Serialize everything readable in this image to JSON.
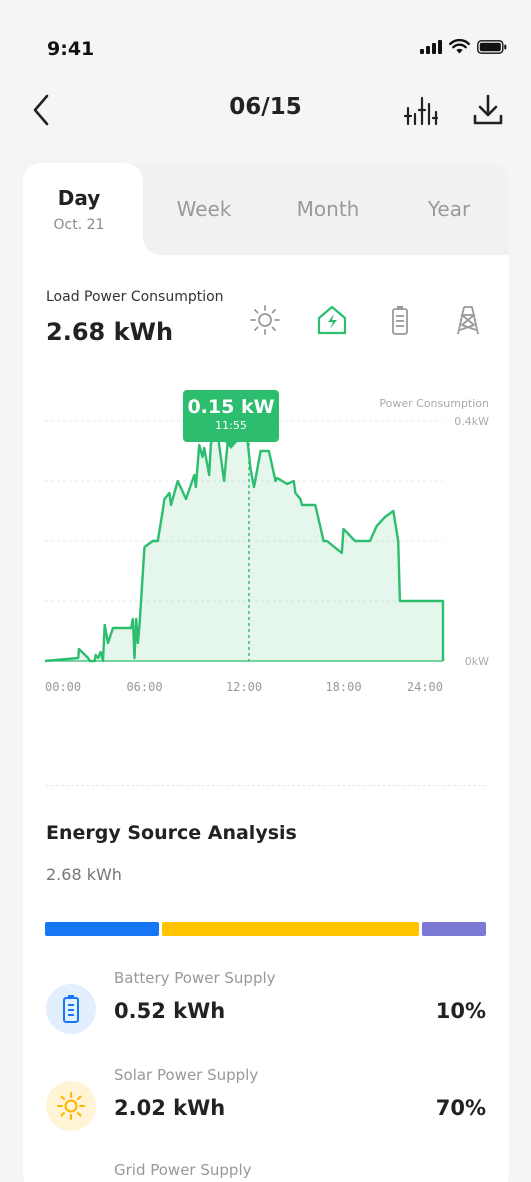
{
  "status": {
    "time": "9:41"
  },
  "header": {
    "title": "06/15"
  },
  "tabs": {
    "day": {
      "label": "Day",
      "date": "Oct. 21"
    },
    "week": "Week",
    "month": "Month",
    "year": "Year"
  },
  "metric": {
    "label": "Load Power Consumption",
    "value": "2.68 kWh"
  },
  "source_icons": [
    "sun-icon",
    "home-power-icon",
    "battery-icon",
    "grid-tower-icon"
  ],
  "colors": {
    "accent_green": "#2dbd6e",
    "battery_blue": "#1677f5",
    "solar_yellow": "#ffc300",
    "grid_purple": "#7b78d6"
  },
  "chart_data": {
    "type": "area",
    "series": [
      {
        "name": "Power Consumption",
        "x": [
          0,
          2,
          2.05,
          2.6,
          2.7,
          3,
          3.05,
          3.2,
          3.35,
          3.5,
          3.6,
          3.8,
          4.1,
          5.2,
          5.3,
          5.4,
          5.5,
          5.6,
          5.7,
          6.0,
          6.5,
          6.8,
          7.1,
          7.2,
          7.5,
          7.6,
          8.0,
          8.5,
          9.0,
          9.1,
          9.3,
          9.5,
          9.6,
          9.9,
          10.0,
          10.2,
          10.4,
          10.8,
          11.0,
          11.2,
          11.5,
          11.7,
          11.9,
          12.0,
          12.2,
          12.4,
          12.6,
          13.0,
          13.5,
          13.9,
          14.0,
          14.6,
          15.0,
          15.1,
          15.4,
          15.5,
          16.1,
          16.3,
          16.8,
          17.0,
          17.9,
          18.0,
          18.7,
          19.6,
          20.0,
          20.5,
          21.0,
          21.3,
          21.4,
          21.6,
          22.0,
          24.0,
          24.0
        ],
        "values": [
          0.0,
          0.005,
          0.02,
          0.005,
          0.0,
          0.0,
          0.01,
          0.005,
          0.015,
          0.0,
          0.06,
          0.03,
          0.055,
          0.055,
          0.07,
          0.005,
          0.07,
          0.03,
          0.06,
          0.19,
          0.2,
          0.2,
          0.25,
          0.27,
          0.28,
          0.26,
          0.3,
          0.27,
          0.31,
          0.29,
          0.36,
          0.34,
          0.355,
          0.31,
          0.36,
          0.385,
          0.38,
          0.3,
          0.36,
          0.37,
          0.365,
          0.395,
          0.375,
          0.4,
          0.37,
          0.32,
          0.29,
          0.35,
          0.35,
          0.3,
          0.305,
          0.295,
          0.3,
          0.28,
          0.27,
          0.26,
          0.26,
          0.26,
          0.2,
          0.2,
          0.18,
          0.22,
          0.2,
          0.2,
          0.225,
          0.24,
          0.25,
          0.2,
          0.1,
          0.1,
          0.1,
          0.1,
          0.0
        ]
      }
    ],
    "x_ticks": [
      "00:00",
      "06:00",
      "12:00",
      "18:00",
      "24:00"
    ],
    "y_ticks": [
      "0kW",
      "0.4kW"
    ],
    "ylabel": "Power Consumption",
    "ylim": [
      0,
      0.4
    ],
    "xlim": [
      0,
      24
    ],
    "selected": {
      "x": 12.3,
      "value_label": "0.15 kW",
      "time_label": "11:55"
    },
    "grid": true
  },
  "analysis": {
    "title": "Energy Source Analysis",
    "total": "2.68 kWh",
    "bar_segments": [
      {
        "name": "battery",
        "share": 0.265
      },
      {
        "name": "solar",
        "share": 0.59
      },
      {
        "name": "grid",
        "share": 0.145
      }
    ],
    "sources": [
      {
        "label": "Battery Power Supply",
        "value": "0.52 kWh",
        "percent": "10%",
        "icon": "battery-icon"
      },
      {
        "label": "Solar Power Supply",
        "value": "2.02 kWh",
        "percent": "70%",
        "icon": "sun-icon"
      },
      {
        "label": "Grid Power Supply",
        "value": "",
        "percent": "",
        "icon": "grid-icon"
      }
    ]
  }
}
